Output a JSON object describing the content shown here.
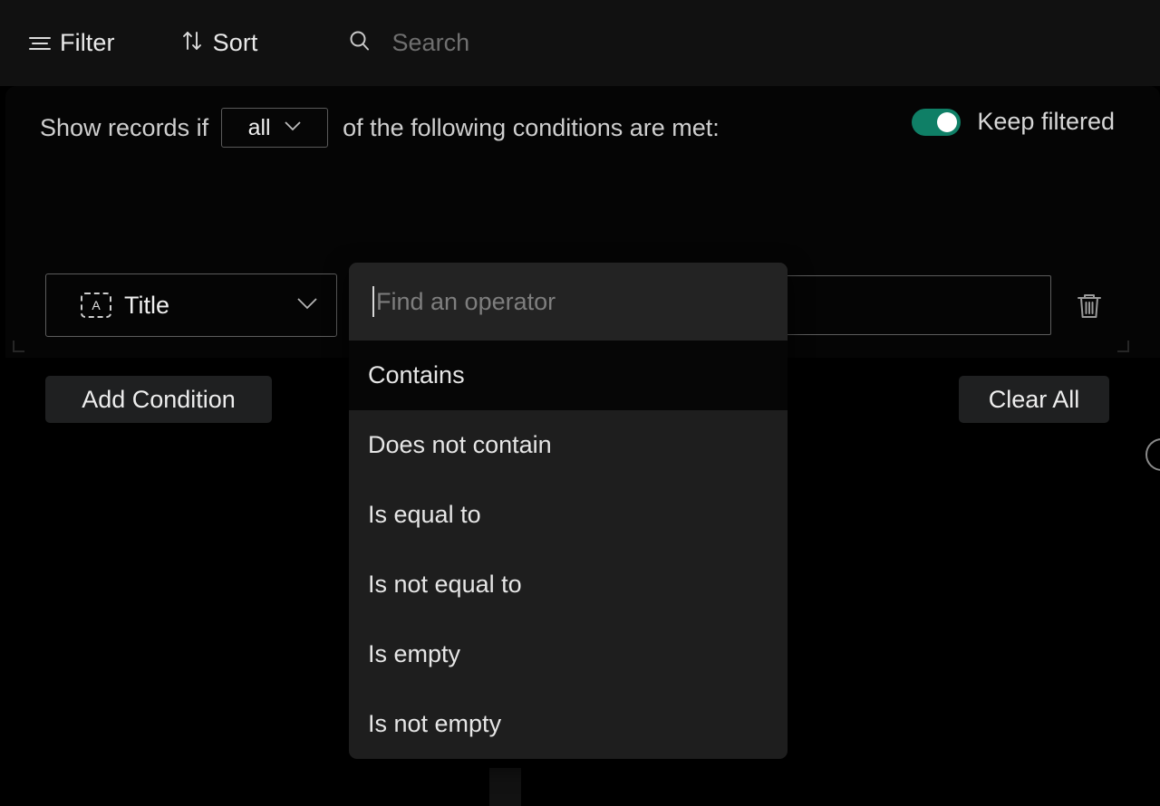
{
  "toolbar": {
    "filter_label": "Filter",
    "sort_label": "Sort",
    "search_placeholder": "Search",
    "filter_icon": "filter-lines-icon",
    "sort_icon": "sort-arrows-icon",
    "search_icon": "search-icon"
  },
  "filter_panel": {
    "lead_text": "Show records if",
    "scope": {
      "value": "all",
      "chevron_icon": "chevron-down-icon"
    },
    "trail_text": "of the following conditions are met:",
    "keep_filtered": {
      "label": "Keep filtered",
      "enabled": true,
      "accent_color": "#0f7f66"
    },
    "condition": {
      "field_type_icon": "text-field-icon",
      "field_type_glyph": "A",
      "field_name": "Title",
      "field_chevron_icon": "chevron-down-icon",
      "operator_value": "Contains",
      "operator_chevron_icon": "chevron-down-icon",
      "operator_focus_color": "#15a07c",
      "value_text": "",
      "delete_icon": "trash-icon"
    },
    "add_condition_label": "Add Condition",
    "clear_all_label": "Clear All"
  },
  "operator_dropdown": {
    "search_placeholder": "Find an operator",
    "selected": "Contains",
    "options": [
      {
        "label": "Contains"
      },
      {
        "label": "Does not contain"
      },
      {
        "label": "Is equal to"
      },
      {
        "label": "Is not equal to"
      },
      {
        "label": "Is empty"
      },
      {
        "label": "Is not empty"
      }
    ]
  }
}
